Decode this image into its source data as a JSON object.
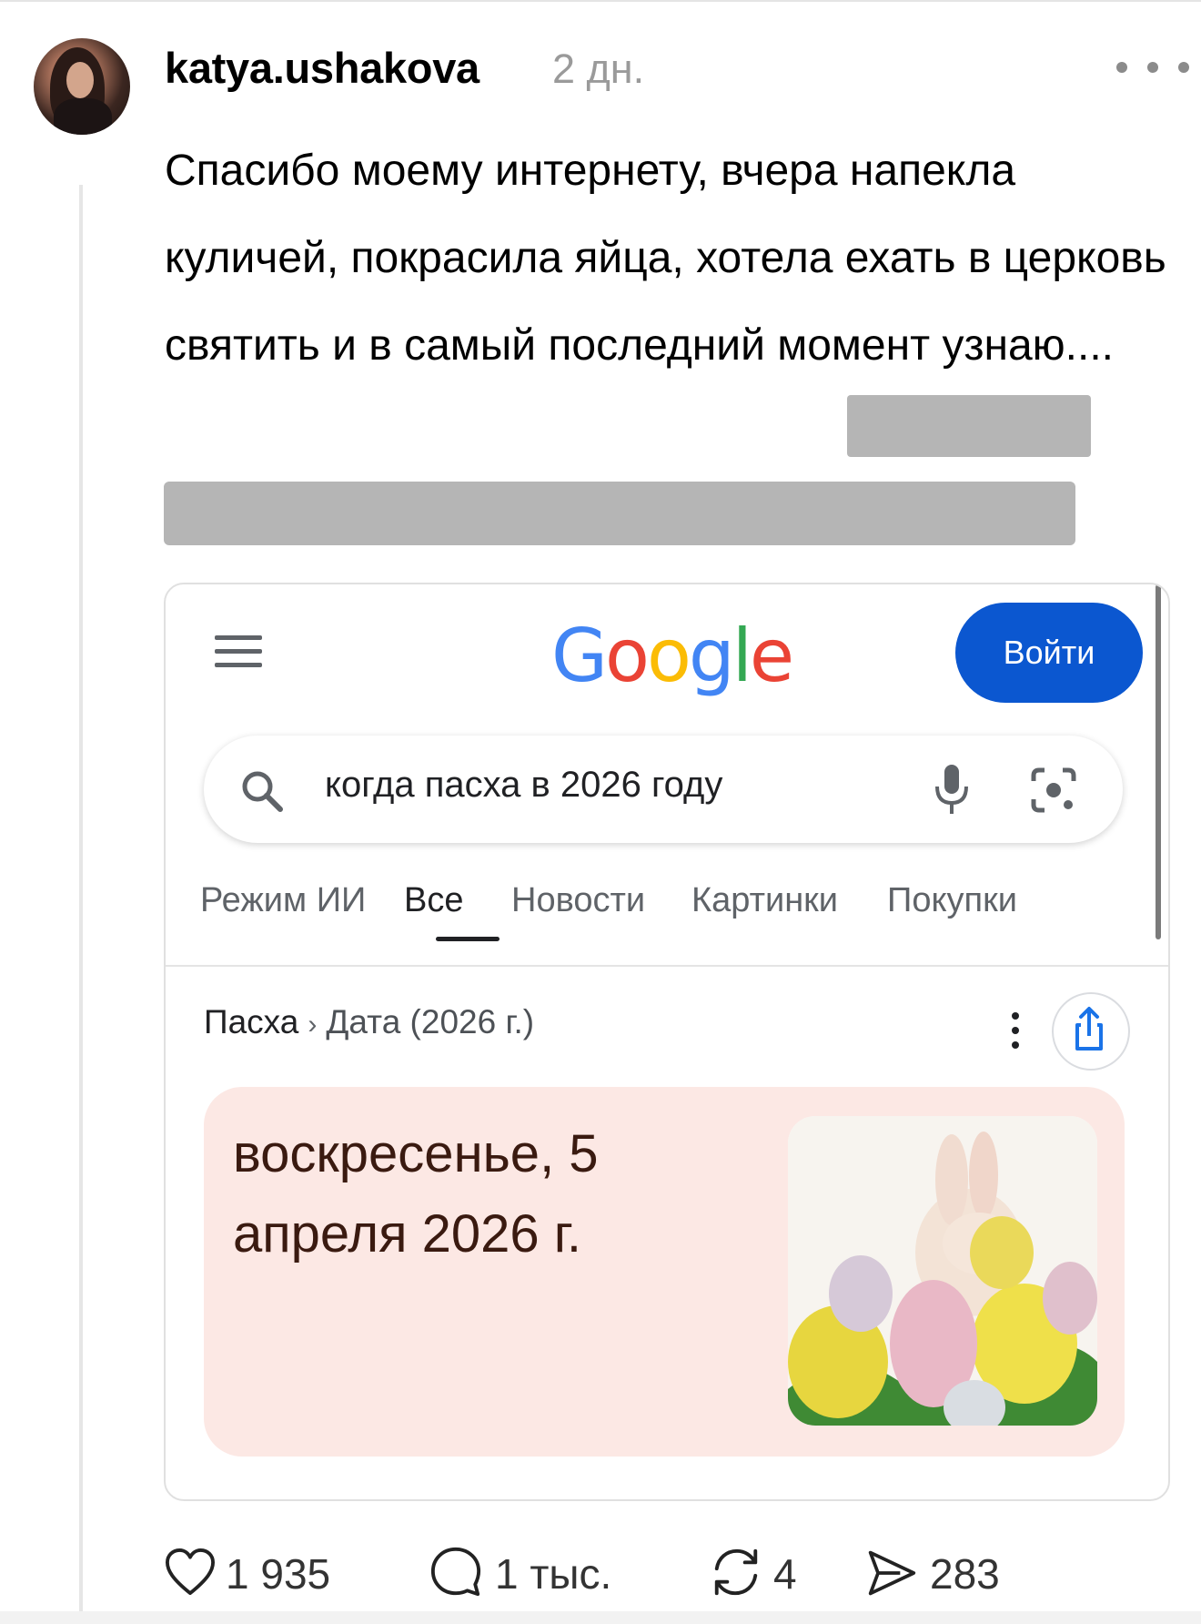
{
  "post": {
    "username": "katya.ushakova",
    "time": "2 дн.",
    "text": "Спасибо моему интернету, вчера напекла куличей, покрасила яйца, хотела ехать в церковь святить и в самый последний момент узнаю...."
  },
  "google": {
    "logo_letters": [
      "G",
      "o",
      "o",
      "g",
      "l",
      "e"
    ],
    "logo_colors": [
      "#4285F4",
      "#EA4335",
      "#FBBC05",
      "#4285F4",
      "#34A853",
      "#EA4335"
    ],
    "signin_label": "Войти",
    "signin_color": "#0b57d0",
    "search_query": "когда пасха в 2026 году",
    "tabs": [
      "Режим ИИ",
      "Все",
      "Новости",
      "Картинки",
      "Покупки"
    ],
    "active_tab": "Все",
    "breadcrumb": {
      "main": "Пасха",
      "sub": "Дата (2026 г.)"
    },
    "answer": "воскресенье, 5 апреля 2026 г."
  },
  "actions": {
    "likes": "1 935",
    "comments": "1 тыс.",
    "reposts": "4",
    "shares": "283"
  },
  "icons": [
    "more-icon",
    "menu-icon",
    "search-icon",
    "mic-icon",
    "lens-icon",
    "kebab-icon",
    "share-icon",
    "heart-icon",
    "comment-icon",
    "repost-icon",
    "send-icon"
  ]
}
